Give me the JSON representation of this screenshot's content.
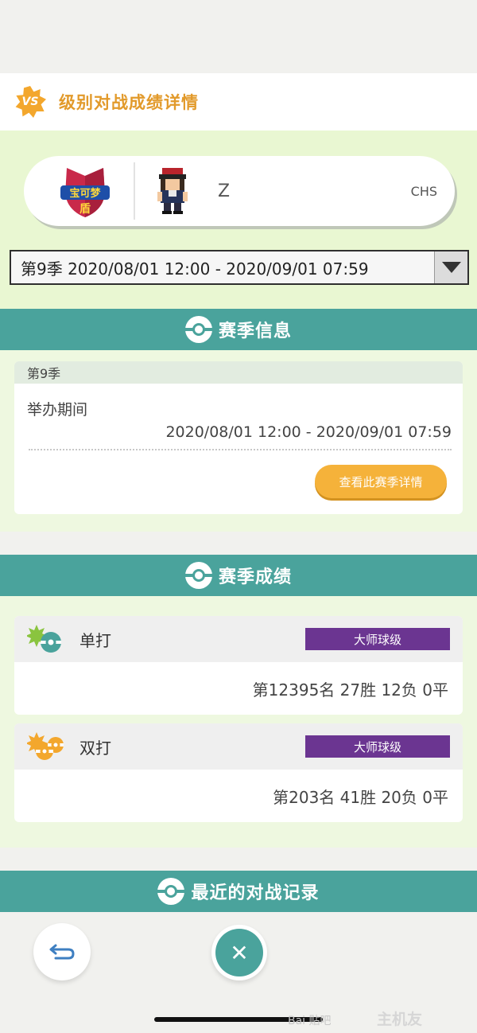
{
  "header": {
    "badge": "VS",
    "title": "级别对战成绩详情"
  },
  "player": {
    "game_logo_line1": "宝可梦",
    "game_logo_line2": "盾",
    "trainer_name": "Z",
    "language": "CHS"
  },
  "season_select": {
    "selected": "第9季 2020/08/01 12:00 - 2020/09/01 07:59"
  },
  "season_info": {
    "section_title": "赛季信息",
    "season_label": "第9季",
    "period_label": "举办期间",
    "period_value": "2020/08/01 12:00 - 2020/09/01 07:59",
    "detail_button": "查看此赛季详情"
  },
  "season_results": {
    "section_title": "赛季成绩",
    "singles": {
      "label": "单打",
      "rank_class": "大师球级",
      "result": "第12395名 27胜 12负 0平"
    },
    "doubles": {
      "label": "双打",
      "rank_class": "大师球级",
      "result": "第203名 41胜 20负 0平"
    }
  },
  "recent_battles": {
    "section_title": "最近的对战记录"
  },
  "footer": {
    "close_symbol": "✕"
  },
  "watermark": {
    "baidu": "Bai 贴吧",
    "site": "主机友"
  },
  "colors": {
    "teal": "#4aa39c",
    "orange": "#f5b23a",
    "purple": "#6b3591",
    "green_bg": "#e9f7d2"
  },
  "icons": [
    "vs-badge-icon",
    "dropdown-arrow-icon",
    "pokeball-icon",
    "singles-icon",
    "doubles-icon",
    "back-icon",
    "close-icon"
  ]
}
